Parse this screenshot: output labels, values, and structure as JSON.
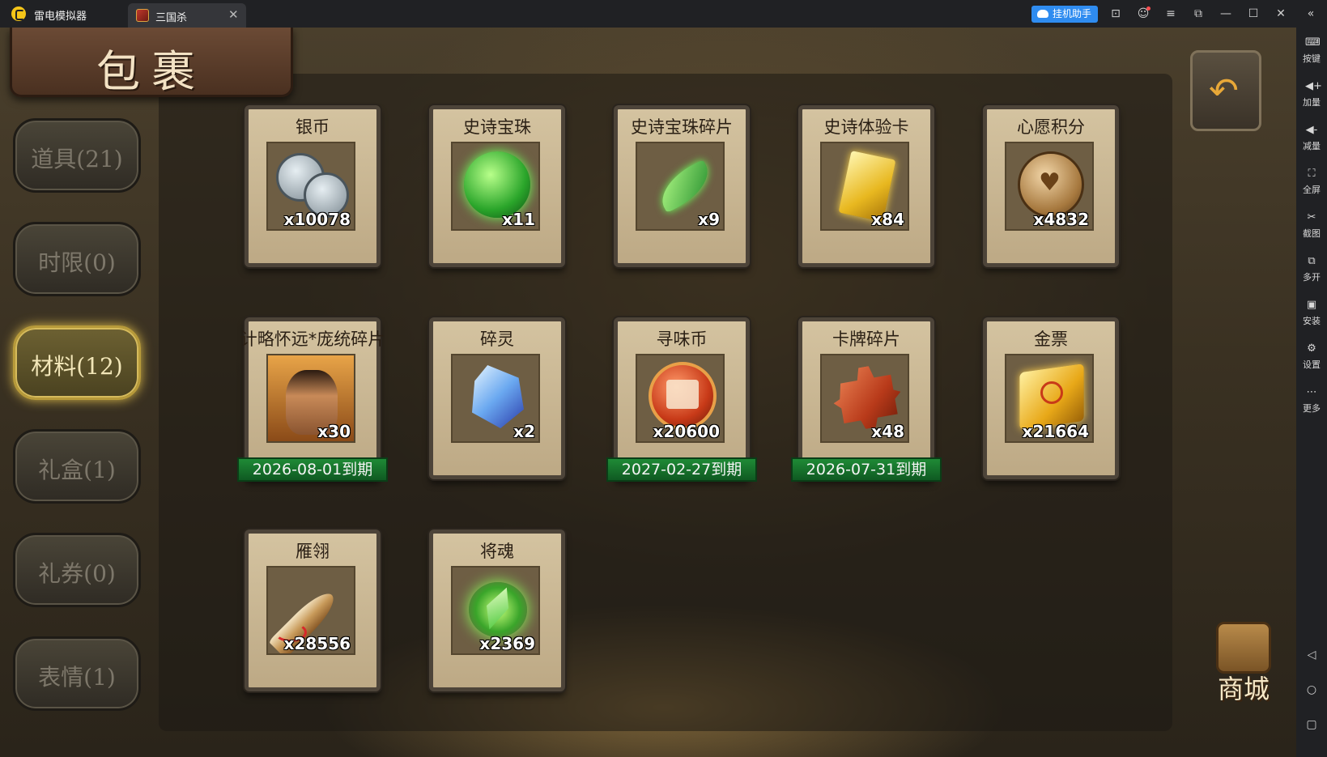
{
  "titlebar": {
    "app_name": "雷电模拟器",
    "tab_label": "三国杀",
    "tab_close": "✕",
    "assist_button": "挂机助手",
    "window_buttons": [
      "⊡",
      "☺",
      "≡",
      "⧉",
      "—",
      "☐",
      "✕",
      "«"
    ]
  },
  "sidebar": {
    "items": [
      {
        "label": "按键",
        "icon": "keyboard-icon",
        "glyph": "⌨"
      },
      {
        "label": "加量",
        "icon": "volume-up-icon",
        "glyph": "◀+"
      },
      {
        "label": "减量",
        "icon": "volume-down-icon",
        "glyph": "◀-"
      },
      {
        "label": "全屏",
        "icon": "fullscreen-icon",
        "glyph": "⛶"
      },
      {
        "label": "截图",
        "icon": "scissors-icon",
        "glyph": "✂"
      },
      {
        "label": "多开",
        "icon": "multi-instance-icon",
        "glyph": "⧉"
      },
      {
        "label": "安装",
        "icon": "apk-install-icon",
        "glyph": "▣"
      },
      {
        "label": "设置",
        "icon": "gear-icon",
        "glyph": "⚙"
      },
      {
        "label": "更多",
        "icon": "more-icon",
        "glyph": "⋯"
      }
    ],
    "nav": {
      "back": "◁",
      "home": "○",
      "recent": "▢"
    }
  },
  "game": {
    "title": "包裹",
    "back_arrow": "↶",
    "shop_label": "商城",
    "categories": [
      {
        "label": "道具(21)",
        "active": false
      },
      {
        "label": "时限(0)",
        "active": false
      },
      {
        "label": "材料(12)",
        "active": true
      },
      {
        "label": "礼盒(1)",
        "active": false
      },
      {
        "label": "礼券(0)",
        "active": false
      },
      {
        "label": "表情(1)",
        "active": false
      }
    ],
    "items": [
      {
        "name": "银币",
        "qty": "x10078",
        "expiry": "",
        "icon": "silver-coin-icon"
      },
      {
        "name": "史诗宝珠",
        "qty": "x11",
        "expiry": "",
        "icon": "green-orb-icon"
      },
      {
        "name": "史诗宝珠碎片",
        "qty": "x9",
        "expiry": "",
        "icon": "green-shard-icon"
      },
      {
        "name": "史诗体验卡",
        "qty": "x84",
        "expiry": "",
        "icon": "gold-card-icon"
      },
      {
        "name": "心愿积分",
        "qty": "x4832",
        "expiry": "",
        "icon": "heart-coin-icon"
      },
      {
        "name": "计略怀远*庞统碎片",
        "qty": "x30",
        "expiry": "2026-08-01到期",
        "icon": "general-portrait-icon"
      },
      {
        "name": "碎灵",
        "qty": "x2",
        "expiry": "",
        "icon": "blue-crystal-icon"
      },
      {
        "name": "寻味币",
        "qty": "x20600",
        "expiry": "2027-02-27到期",
        "icon": "flavor-coin-icon"
      },
      {
        "name": "卡牌碎片",
        "qty": "x48",
        "expiry": "2026-07-31到期",
        "icon": "puzzle-piece-icon"
      },
      {
        "name": "金票",
        "qty": "x21664",
        "expiry": "",
        "icon": "gold-scroll-icon"
      },
      {
        "name": "雁翎",
        "qty": "x28556",
        "expiry": "",
        "icon": "feather-icon"
      },
      {
        "name": "将魂",
        "qty": "x2369",
        "expiry": "",
        "icon": "green-soul-crystal-icon"
      }
    ]
  },
  "colors": {
    "titlebar_bg": "#202124",
    "assist_blue": "#2f8cf0",
    "expiry_green": "#1f8a36",
    "card_bg": "#d4c3a0",
    "active_tab_gold": "#d8b84a"
  }
}
